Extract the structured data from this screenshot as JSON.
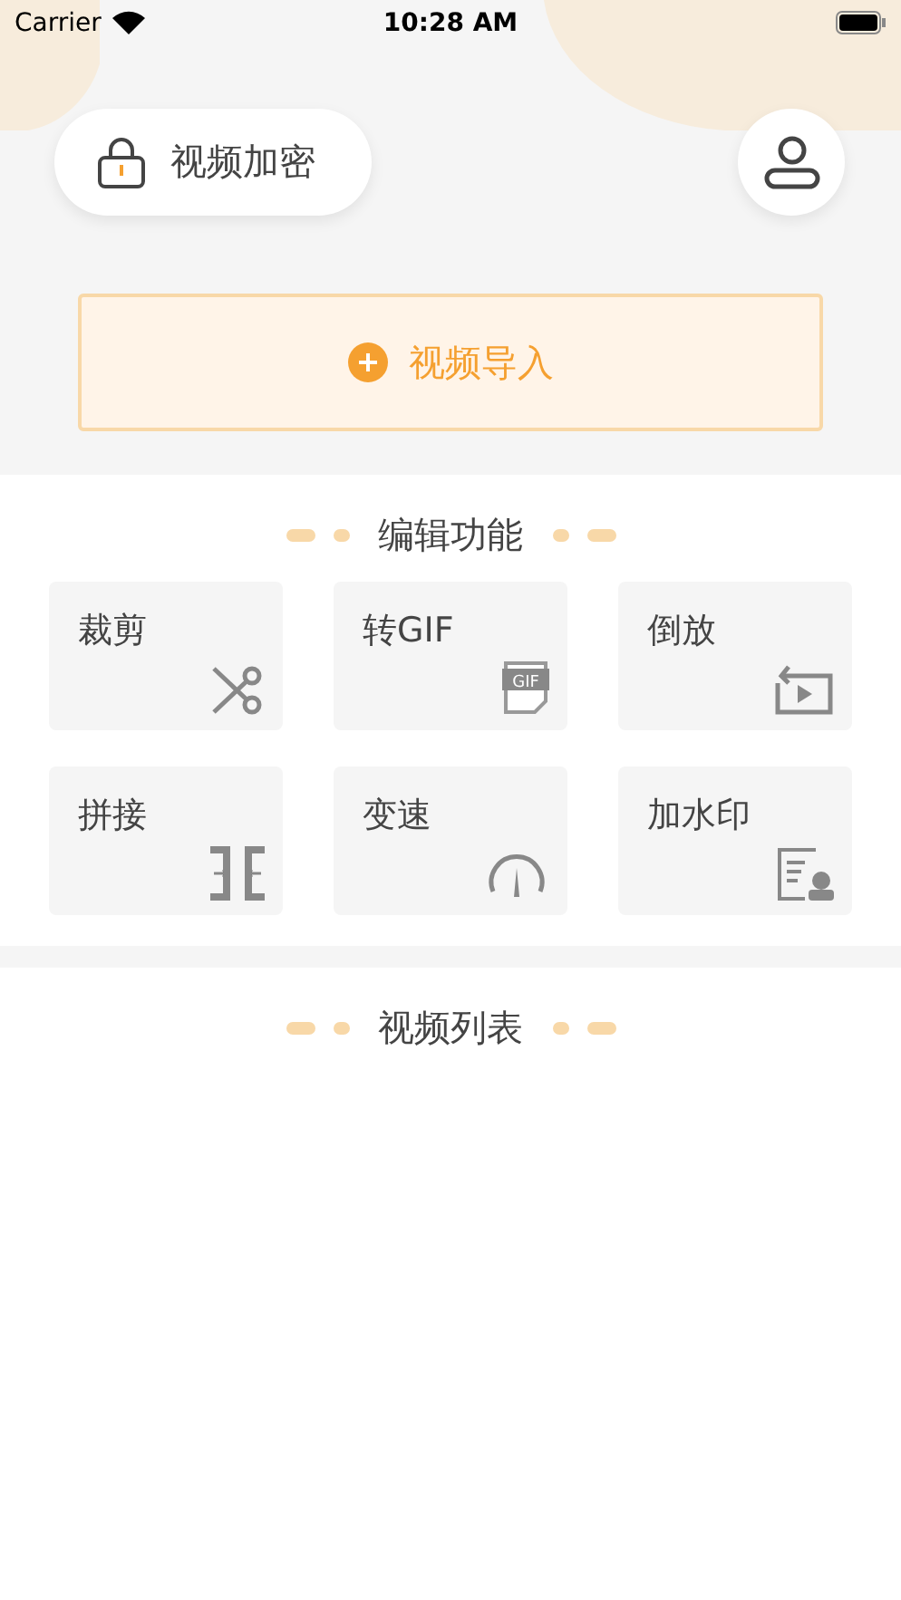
{
  "status_bar": {
    "carrier": "Carrier",
    "time": "10:28 AM"
  },
  "header": {
    "encrypt_label": "视频加密"
  },
  "import": {
    "label": "视频导入"
  },
  "edit_section": {
    "title": "编辑功能",
    "tools": [
      {
        "kind": "scissors",
        "label": "裁剪"
      },
      {
        "kind": "gif",
        "label": "转GIF",
        "badge": "GIF"
      },
      {
        "kind": "reverse",
        "label": "倒放"
      },
      {
        "kind": "join",
        "label": "拼接"
      },
      {
        "kind": "speed",
        "label": "变速"
      },
      {
        "kind": "watermark",
        "label": "加水印"
      }
    ]
  },
  "video_section": {
    "title": "视频列表"
  }
}
